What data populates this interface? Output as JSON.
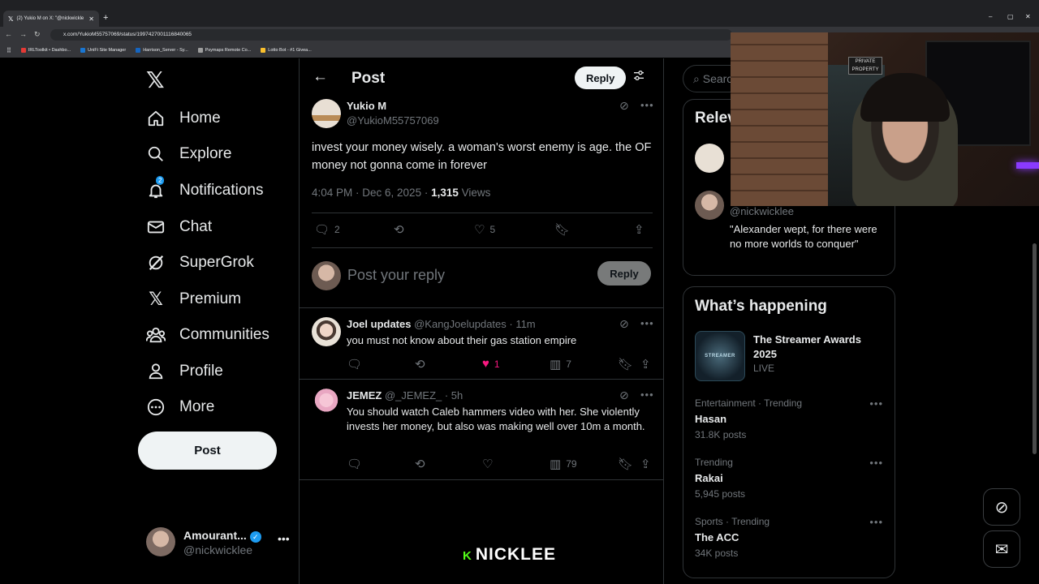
{
  "browser": {
    "tab_title": "(2) Yukio M on X: \"@nickwickle",
    "new_tab": "+",
    "url": "x.com/YukioM55757069/status/1997427001116840065",
    "bookmarks": [
      {
        "label": "IRLToolkit • Dashbo...",
        "color": "#e53935"
      },
      {
        "label": "UniFi Site Manager",
        "color": "#1976d2"
      },
      {
        "label": "Harrison_Server - Sy...",
        "color": "#1565c0"
      },
      {
        "label": "Psymaps Remote Co...",
        "color": "#9e9e9e"
      },
      {
        "label": "Lotto Bot - #1 Givea...",
        "color": "#fbc02d"
      }
    ],
    "window_controls": [
      "–",
      "▢",
      "✕"
    ]
  },
  "nav": {
    "items": [
      {
        "label": "Home",
        "icon": "home-icon"
      },
      {
        "label": "Explore",
        "icon": "search-icon"
      },
      {
        "label": "Notifications",
        "icon": "bell-icon",
        "badge": "2"
      },
      {
        "label": "Chat",
        "icon": "mail-icon"
      },
      {
        "label": "SuperGrok",
        "icon": "grok-icon"
      },
      {
        "label": "Premium",
        "icon": "x-icon"
      },
      {
        "label": "Communities",
        "icon": "people-icon"
      },
      {
        "label": "Profile",
        "icon": "person-icon"
      },
      {
        "label": "More",
        "icon": "more-circle-icon"
      }
    ],
    "post_button": "Post",
    "account": {
      "name": "Amourant...",
      "handle": "@nickwicklee"
    }
  },
  "header": {
    "title": "Post",
    "reply_button": "Reply"
  },
  "post": {
    "name": "Yukio M",
    "handle": "@YukioM55757069",
    "text": "invest your money wisely. a woman's worst enemy is age. the OF money not gonna come in forever",
    "time": "4:04 PM · Dec 6, 2025 · ",
    "views_count": "1,315",
    "views_label": " Views",
    "replies": "2",
    "likes": "5"
  },
  "compose": {
    "placeholder": "Post your reply",
    "button": "Reply"
  },
  "replies": [
    {
      "name": "Joel updates",
      "handle": "@KangJoelupdates · 11m",
      "text": "you must not know about their gas station empire",
      "likes": "1",
      "views": "7"
    },
    {
      "name": "JEMEZ",
      "handle": "@_JEMEZ_ · 5h",
      "text": "You should watch Caleb hammers video with her. She violently invests her money, but also was making well over 10m a month.",
      "likes": "",
      "views": "79"
    }
  ],
  "sidebar": {
    "search_placeholder": "Searc",
    "relevant_title": "Relev",
    "relevant_handle": "@nickwicklee",
    "relevant_bio": "\"Alexander wept, for there were no more worlds to conquer\"",
    "happening_title": "What’s happening",
    "event": {
      "title": "The Streamer Awards 2025",
      "status": "LIVE",
      "thumb_text": "STREAMER"
    },
    "trends": [
      {
        "context": "Entertainment · Trending",
        "name": "Hasan",
        "count": "31.8K posts"
      },
      {
        "context": "Trending",
        "name": "Rakai",
        "count": "5,945 posts"
      },
      {
        "context": "Sports · Trending",
        "name": "The ACC",
        "count": "34K posts"
      }
    ]
  },
  "overlay": {
    "watermark": "NICKLEE",
    "cam_sign": "PRIVATE PROPERTY"
  },
  "colors": {
    "accent": "#1d9bf0",
    "like": "#f91880",
    "kick": "#53fc18"
  }
}
